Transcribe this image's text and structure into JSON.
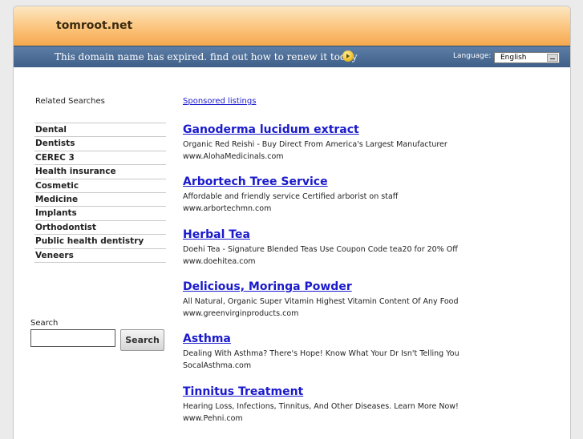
{
  "header": {
    "site_name": "tomroot.net",
    "notice": "This domain name has expired. find out how to renew it today",
    "notice_icon": "arrow-right-circle-icon",
    "language_label": "Language:",
    "language_value": "English"
  },
  "sidebar": {
    "related_title": "Related Searches",
    "items": [
      {
        "label": "Dental"
      },
      {
        "label": "Dentists"
      },
      {
        "label": "CEREC 3"
      },
      {
        "label": "Health insurance"
      },
      {
        "label": "Cosmetic"
      },
      {
        "label": "Medicine"
      },
      {
        "label": "Implants"
      },
      {
        "label": "Orthodontist"
      },
      {
        "label": "Public health dentistry"
      },
      {
        "label": "Veneers"
      }
    ],
    "search_label": "Search",
    "search_value": "",
    "search_button": "Search"
  },
  "main": {
    "sponsored_label": "Sponsored listings",
    "listings": [
      {
        "title": "Ganoderma lucidum extract",
        "desc": "Organic Red Reishi - Buy Direct From America's Largest Manufacturer",
        "url": "www.AlohaMedicinals.com"
      },
      {
        "title": "Arbortech Tree Service",
        "desc": "Affordable and friendly service Certified arborist on staff",
        "url": "www.arbortechmn.com"
      },
      {
        "title": "Herbal Tea",
        "desc": "Doehi Tea - Signature Blended Teas Use Coupon Code tea20 for 20% Off",
        "url": "www.doehitea.com"
      },
      {
        "title": "Delicious, Moringa Powder",
        "desc": "All Natural, Organic Super Vitamin Highest Vitamin Content Of Any Food",
        "url": "www.greenvirginproducts.com"
      },
      {
        "title": "Asthma",
        "desc": "Dealing With Asthma? There's Hope! Know What Your Dr Isn't Telling You",
        "url": "SocalAsthma.com"
      },
      {
        "title": "Tinnitus Treatment",
        "desc": "Hearing Loss, Infections, Tinnitus, And Other Diseases. Learn More Now!",
        "url": "www.Pehni.com"
      }
    ]
  },
  "colors": {
    "link": "#1a1acc",
    "header_orange": "#fbc47c",
    "notice_blue": "#4a6a94"
  }
}
